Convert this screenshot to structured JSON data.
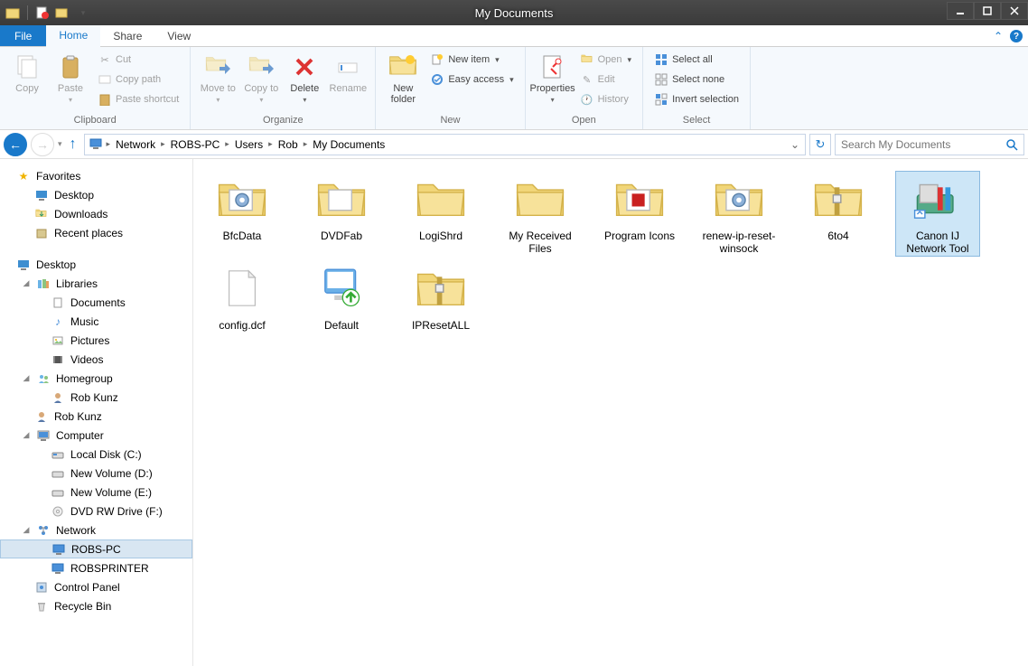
{
  "window": {
    "title": "My Documents"
  },
  "tabs": {
    "file": "File",
    "home": "Home",
    "share": "Share",
    "view": "View"
  },
  "ribbon": {
    "clipboard": {
      "label": "Clipboard",
      "copy": "Copy",
      "paste": "Paste",
      "cut": "Cut",
      "copy_path": "Copy path",
      "paste_shortcut": "Paste shortcut"
    },
    "organize": {
      "label": "Organize",
      "move_to": "Move to",
      "copy_to": "Copy to",
      "delete": "Delete",
      "rename": "Rename"
    },
    "new": {
      "label": "New",
      "new_folder": "New folder",
      "new_item": "New item",
      "easy_access": "Easy access"
    },
    "open": {
      "label": "Open",
      "properties": "Properties",
      "open": "Open",
      "edit": "Edit",
      "history": "History"
    },
    "select": {
      "label": "Select",
      "select_all": "Select all",
      "select_none": "Select none",
      "invert": "Invert selection"
    }
  },
  "breadcrumb": [
    "Network",
    "ROBS-PC",
    "Users",
    "Rob",
    "My Documents"
  ],
  "search": {
    "placeholder": "Search My Documents"
  },
  "sidebar": {
    "favorites": {
      "label": "Favorites",
      "items": [
        "Desktop",
        "Downloads",
        "Recent places"
      ]
    },
    "desktop": {
      "label": "Desktop",
      "libraries": {
        "label": "Libraries",
        "items": [
          "Documents",
          "Music",
          "Pictures",
          "Videos"
        ]
      },
      "homegroup": {
        "label": "Homegroup",
        "items": [
          "Rob Kunz"
        ]
      },
      "rob_kunz": "Rob Kunz",
      "computer": {
        "label": "Computer",
        "items": [
          "Local Disk (C:)",
          "New Volume (D:)",
          "New Volume (E:)",
          "DVD RW Drive (F:)"
        ]
      },
      "network": {
        "label": "Network",
        "items": [
          "ROBS-PC",
          "ROBSPRINTER"
        ]
      },
      "control_panel": "Control Panel",
      "recycle_bin": "Recycle Bin"
    }
  },
  "files": [
    {
      "name": "BfcData",
      "type": "folder-gear"
    },
    {
      "name": "DVDFab",
      "type": "folder-open"
    },
    {
      "name": "LogiShrd",
      "type": "folder"
    },
    {
      "name": "My Received Files",
      "type": "folder"
    },
    {
      "name": "Program Icons",
      "type": "folder-redicon"
    },
    {
      "name": "renew-ip-reset-winsock",
      "type": "folder-gear"
    },
    {
      "name": "6to4",
      "type": "zip"
    },
    {
      "name": "Canon IJ Network Tool",
      "type": "app",
      "selected": true
    },
    {
      "name": "config.dcf",
      "type": "file"
    },
    {
      "name": "Default",
      "type": "rdp"
    },
    {
      "name": "IPResetALL",
      "type": "zip"
    }
  ]
}
